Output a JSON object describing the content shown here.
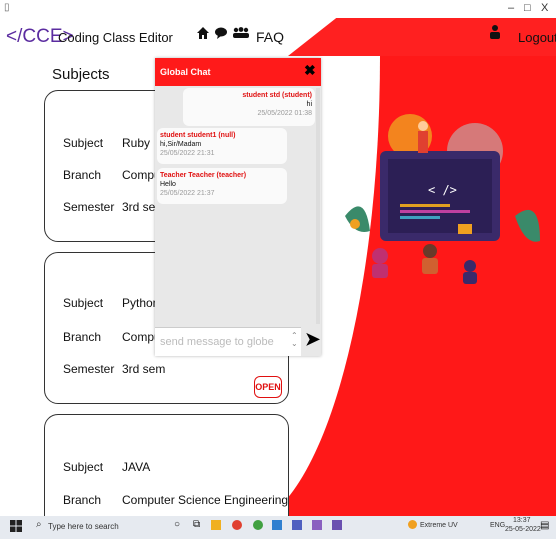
{
  "window": {
    "controls": [
      "–",
      "□",
      "X"
    ]
  },
  "header": {
    "logo": "</CCE>",
    "app_title": "Coding Class Editor",
    "faq_label": "FAQ",
    "logout_label": "Logout",
    "icons": [
      "home-icon",
      "chat-icon",
      "group-icon",
      "user-icon"
    ]
  },
  "main": {
    "subjects_title": "Subjects",
    "cards": [
      {
        "subject_label": "Subject",
        "subject_value": "Ruby",
        "branch_label": "Branch",
        "branch_value": "Compute",
        "semester_label": "Semester",
        "semester_value": "3rd sem"
      },
      {
        "subject_label": "Subject",
        "subject_value": "Python",
        "branch_label": "Branch",
        "branch_value": "Compute",
        "semester_label": "Semester",
        "semester_value": "3rd sem",
        "open_label": "OPEN"
      },
      {
        "subject_label": "Subject",
        "subject_value": "JAVA",
        "branch_label": "Branch",
        "branch_value": "Computer Science Engineering"
      }
    ]
  },
  "chat": {
    "title": "Global Chat",
    "messages": [
      {
        "sender": "student std (student)",
        "text": "hi",
        "time": "25/05/2022 01:38",
        "align": "right"
      },
      {
        "sender": "student student1 (null)",
        "text": "hi,Sir/Madam",
        "time": "25/05/2022 21:31",
        "align": "left"
      },
      {
        "sender": "Teacher Teacher (teacher)",
        "text": "Hello",
        "time": "25/05/2022 21:37",
        "align": "left"
      }
    ],
    "input_placeholder": "send message to globe"
  },
  "taskbar": {
    "search_placeholder": "Type here to search",
    "weather": "Extreme UV",
    "lang": "ENG",
    "time": "13:37",
    "date": "25-05-2022"
  },
  "colors": {
    "accent": "#ff1a1a",
    "logo": "#5b2ca0"
  }
}
